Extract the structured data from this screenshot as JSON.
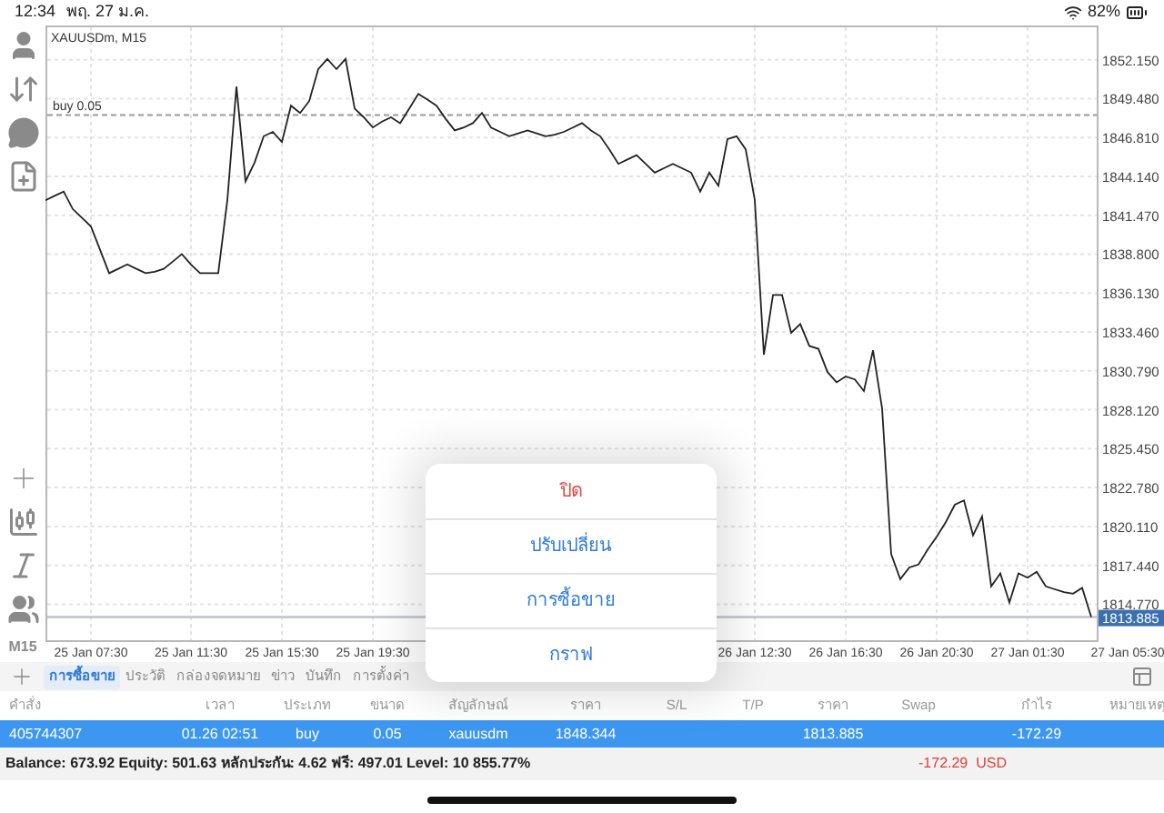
{
  "status_bar": {
    "time": "12:34",
    "date": "พฤ. 27 ม.ค.",
    "battery": "82%"
  },
  "toolbar": {
    "timeframe": "M15"
  },
  "chart": {
    "chart_data": {
      "type": "line",
      "title": "XAUUSDm, M15",
      "ylim": [
        1812.3,
        1854.5
      ],
      "categories": [
        null,
        null,
        null,
        null,
        null,
        "25 Jan 07:30",
        null,
        null,
        null,
        null,
        null,
        null,
        null,
        null,
        null,
        null,
        "25 Jan 11:30",
        null,
        null,
        null,
        null,
        null,
        null,
        null,
        null,
        null,
        "25 Jan 15:30",
        null,
        null,
        null,
        null,
        null,
        null,
        null,
        null,
        null,
        "25 Jan 19:30",
        null,
        null,
        null,
        null,
        null,
        null,
        null,
        null,
        null,
        null,
        null,
        null,
        null,
        null,
        null,
        null,
        null,
        null,
        null,
        null,
        null,
        null,
        null,
        null,
        null,
        null,
        null,
        null,
        null,
        null,
        null,
        null,
        null,
        null,
        null,
        null,
        null,
        null,
        null,
        null,
        null,
        "26 Jan 12:30",
        null,
        null,
        null,
        null,
        null,
        null,
        null,
        null,
        null,
        "26 Jan 16:30",
        null,
        null,
        null,
        null,
        null,
        null,
        null,
        null,
        null,
        "26 Jan 20:30",
        null,
        null,
        null,
        null,
        null,
        null,
        null,
        null,
        null,
        "27 Jan 01:30",
        null,
        null,
        null,
        null,
        null,
        null,
        null,
        null,
        null,
        null,
        "27 Jan 05:30"
      ],
      "series": [
        {
          "color": "#222222",
          "values": [
            1842.5,
            1842.8,
            1843.1,
            1841.9,
            1841.3,
            1840.7,
            1839.1,
            1837.5,
            1837.8,
            1838.1,
            1837.8,
            1837.5,
            1837.6,
            1837.8,
            1838.3,
            1838.8,
            1838.1,
            1837.5,
            1837.5,
            1837.5,
            1842.5,
            1850.3,
            1843.8,
            1845.1,
            1846.9,
            1847.2,
            1846.5,
            1849.0,
            1848.5,
            1849.3,
            1851.5,
            1852.2,
            1851.5,
            1852.2,
            1848.8,
            1848.2,
            1847.5,
            1847.9,
            1848.2,
            1847.8,
            1848.8,
            1849.8,
            1849.4,
            1849.0,
            1848.1,
            1847.3,
            1847.5,
            1847.8,
            1848.5,
            1847.5,
            1847.2,
            1846.9,
            1847.1,
            1847.3,
            1847.1,
            1846.9,
            1847.0,
            1847.2,
            1847.5,
            1847.8,
            1847.3,
            1846.9,
            1846.0,
            1845.0,
            1845.3,
            1845.6,
            1845.0,
            1844.4,
            1844.7,
            1845.0,
            1844.7,
            1844.4,
            1843.1,
            1844.4,
            1843.5,
            1846.7,
            1846.9,
            1846.0,
            1842.5,
            1831.9,
            1836.0,
            1836.0,
            1833.4,
            1834.0,
            1832.5,
            1832.3,
            1830.7,
            1830.0,
            1830.4,
            1830.2,
            1829.4,
            1832.2,
            1828.2,
            1818.2,
            1816.5,
            1817.3,
            1817.5,
            1818.5,
            1819.4,
            1820.4,
            1821.6,
            1821.9,
            1819.5,
            1820.8,
            1816.0,
            1816.9,
            1814.9,
            1816.9,
            1816.6,
            1817.0,
            1816.0,
            1815.8,
            1815.6,
            1815.5,
            1815.9,
            1813.9,
            null,
            null,
            null,
            null
          ]
        }
      ],
      "yticks": [
        {
          "value": 1852.15,
          "label": "1852.150"
        },
        {
          "value": 1849.48,
          "label": "1849.480"
        },
        {
          "value": 1846.81,
          "label": "1846.810"
        },
        {
          "value": 1844.14,
          "label": "1844.140"
        },
        {
          "value": 1841.47,
          "label": "1841.470"
        },
        {
          "value": 1838.8,
          "label": "1838.800"
        },
        {
          "value": 1836.13,
          "label": "1836.130"
        },
        {
          "value": 1833.46,
          "label": "1833.460"
        },
        {
          "value": 1830.79,
          "label": "1830.790"
        },
        {
          "value": 1828.12,
          "label": "1828.120"
        },
        {
          "value": 1825.45,
          "label": "1825.450"
        },
        {
          "value": 1822.78,
          "label": "1822.780"
        },
        {
          "value": 1820.11,
          "label": "1820.110"
        },
        {
          "value": 1817.44,
          "label": "1817.440"
        },
        {
          "value": 1814.77,
          "label": "1814.770"
        }
      ],
      "grid": true,
      "ref_lines": [
        {
          "axis": "y",
          "value": 1848.344,
          "label": "buy 0.05"
        },
        {
          "axis": "y",
          "value": 1813.885,
          "label": "1813.885"
        }
      ]
    }
  },
  "popup_menu": {
    "items": [
      {
        "label": "ปิด",
        "kind": "destructive"
      },
      {
        "label": "ปรับเปลี่ยน",
        "kind": "normal"
      },
      {
        "label": "การซื้อขาย",
        "kind": "normal"
      },
      {
        "label": "กราฟ",
        "kind": "normal"
      }
    ]
  },
  "tabs": [
    {
      "label": "การซื้อขาย",
      "selected": true
    },
    {
      "label": "ประวัติ",
      "selected": false
    },
    {
      "label": "กล่องจดหมาย",
      "selected": false
    },
    {
      "label": "ข่าว",
      "selected": false
    },
    {
      "label": "บันทึก",
      "selected": false
    },
    {
      "label": "การตั้งค่า",
      "selected": false
    }
  ],
  "table": {
    "columns": [
      "คำสั่ง",
      "เวลา",
      "ประเภท",
      "ขนาด",
      "สัญลักษณ์",
      "ราคา",
      "S/L",
      "T/P",
      "ราคา",
      "Swap",
      "กำไร",
      "หมายเหตุ"
    ],
    "rows": [
      {
        "selected": true,
        "cells": [
          "405744307",
          "01.26 02:51",
          "buy",
          "0.05",
          "xauusdm",
          "1848.344",
          "",
          "",
          "1813.885",
          "",
          "-172.29",
          ""
        ]
      }
    ]
  },
  "summary": {
    "text": "Balance: 673.92 Equity: 501.63 หลักประกัน: 4.62 ฟรี: 497.01 Level: 10 855.77%",
    "profit": "-172.29  USD"
  }
}
